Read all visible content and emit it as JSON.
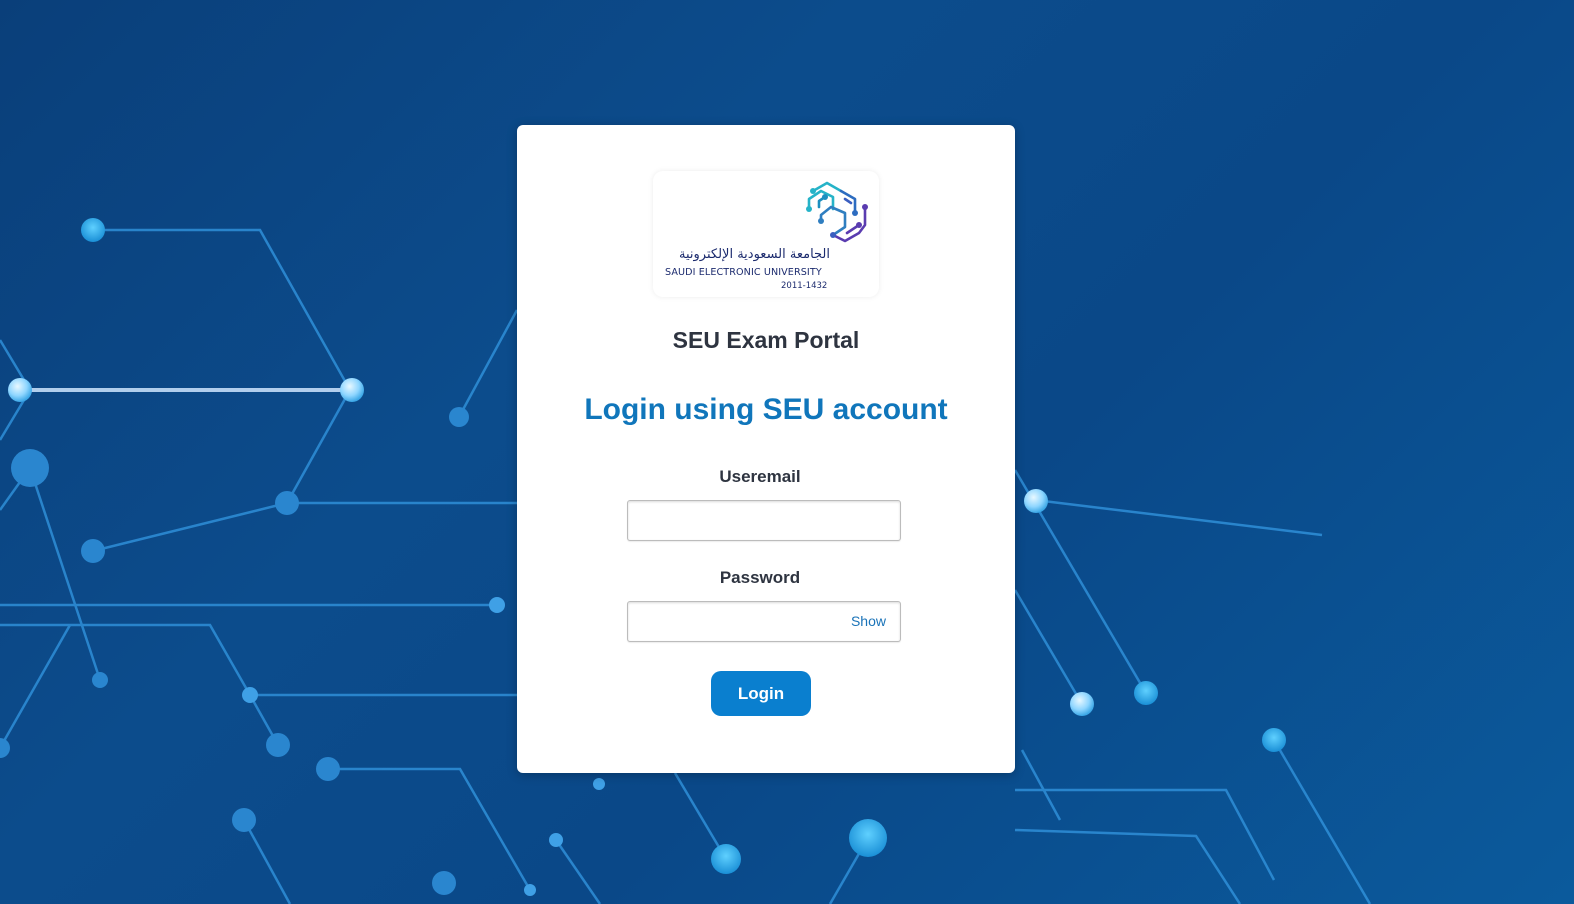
{
  "page": {
    "portal_title": "SEU Exam Portal",
    "login_heading": "Login using SEU account"
  },
  "logo": {
    "icon": "seu-logo-icon",
    "arabic_name": "الجامعة السعودية الإلكترونية",
    "english_name": "SAUDI ELECTRONIC UNIVERSITY",
    "year": "2011-1432"
  },
  "form": {
    "email_label": "Useremail",
    "email_value": "",
    "email_placeholder": "",
    "password_label": "Password",
    "password_value": "",
    "password_placeholder": "",
    "show_label": "Show",
    "login_label": "Login"
  },
  "colors": {
    "background": "#0c4c8c",
    "accent": "#1076bb",
    "button": "#0a7fcf",
    "title_text": "#2e3440"
  }
}
